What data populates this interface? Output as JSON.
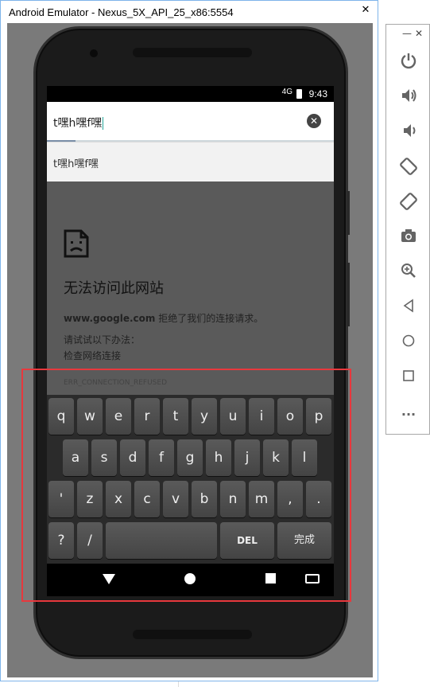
{
  "window": {
    "title": "Android Emulator - Nexus_5X_API_25_x86:5554",
    "close": "✕"
  },
  "status_bar": {
    "network": "4G",
    "time": "9:43"
  },
  "address_bar": {
    "value": "t嘿h嘿f嘿",
    "clear_icon": "✕"
  },
  "suggestion": {
    "text": "t嘿h嘿f嘿"
  },
  "error_page": {
    "title": "无法访问此网站",
    "domain": "www.google.com",
    "domain_suffix": " 拒绝了我们的连接请求。",
    "try_text": "请试试以下办法：",
    "check_text": "检查网络连接",
    "error_code": "ERR_CONNECTION_REFUSED"
  },
  "keyboard": {
    "row1": [
      "q",
      "w",
      "e",
      "r",
      "t",
      "y",
      "u",
      "i",
      "o",
      "p"
    ],
    "row2": [
      "a",
      "s",
      "d",
      "f",
      "g",
      "h",
      "j",
      "k",
      "l"
    ],
    "row3": [
      "'",
      "z",
      "x",
      "c",
      "v",
      "b",
      "n",
      "m",
      ",",
      "."
    ],
    "row4": {
      "question": "?",
      "slash": "/",
      "space": "",
      "del": "DEL",
      "done": "完成"
    }
  },
  "side_panel": {
    "minimize": "—",
    "close": "✕",
    "icons": [
      "power-icon",
      "volume-up-icon",
      "volume-down-icon",
      "rotate-left-icon",
      "rotate-right-icon",
      "camera-icon",
      "zoom-icon",
      "back-icon",
      "home-icon",
      "overview-icon",
      "more-icon"
    ],
    "more_label": "..."
  },
  "colors": {
    "highlight_box": "#e8383d",
    "cursor": "#26a69a"
  }
}
